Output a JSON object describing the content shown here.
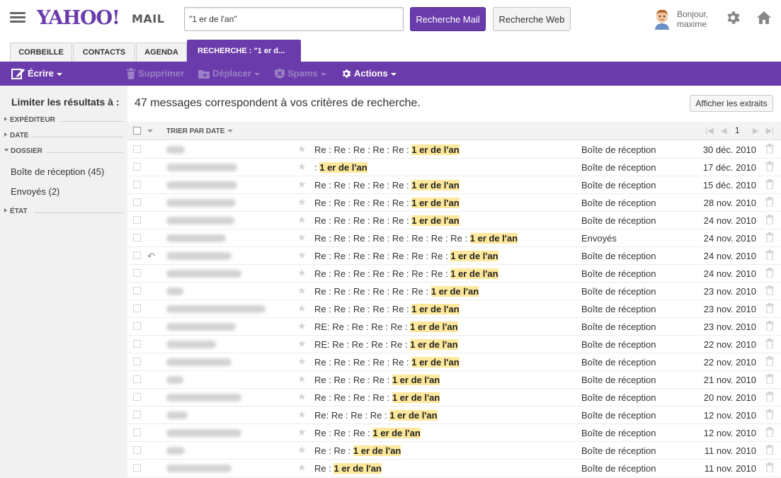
{
  "header": {
    "logo_text": "YAHOO!",
    "logo_mail": "MAIL",
    "search_value": "\"1 er de l'an\"",
    "search_mail_label": "Recherche Mail",
    "search_web_label": "Recherche Web",
    "greeting_line1": "Bonjour,",
    "greeting_line2": "maxime"
  },
  "tabs": [
    {
      "label": "CORBEILLE"
    },
    {
      "label": "CONTACTS"
    },
    {
      "label": "AGENDA"
    },
    {
      "label": "RECHERCHE : \"1 er d..."
    }
  ],
  "toolbar": {
    "write": "Écrire",
    "delete": "Supprimer",
    "move": "Déplacer",
    "spam": "Spams",
    "actions": "Actions"
  },
  "sidebar": {
    "title": "Limiter les résultats à :",
    "sections": {
      "sender": "EXPÉDITEUR",
      "date": "DATE",
      "folder": "DOSSIER",
      "state": "ÉTAT"
    },
    "folders": [
      {
        "name": "Boîte de réception",
        "count": "(45)"
      },
      {
        "name": "Envoyés",
        "count": "(2)"
      }
    ]
  },
  "main": {
    "result_text": "47 messages correspondent à vos critères de recherche.",
    "extracts_button": "Afficher les extraits",
    "sort_label": "TRIER PAR DATE",
    "page_number": "1"
  },
  "colors": {
    "brand": "#6a3cab",
    "highlight": "#fde89b"
  },
  "messages": [
    {
      "prefix": "Re : Re : Re : Re : Re : ",
      "match": "1 er de l'an",
      "folder": "Boîte de réception",
      "date": "30 déc. 2010",
      "replied": false
    },
    {
      "prefix": ": ",
      "match": "1 er de l'an",
      "folder": "Boîte de réception",
      "date": "17 déc. 2010",
      "replied": false
    },
    {
      "prefix": "Re : Re : Re : Re : Re : ",
      "match": "1 er de l'an",
      "folder": "Boîte de réception",
      "date": "15 déc. 2010",
      "replied": false
    },
    {
      "prefix": "Re : Re : Re : Re : Re : ",
      "match": "1 er de l'an",
      "folder": "Boîte de réception",
      "date": "28 nov. 2010",
      "replied": false
    },
    {
      "prefix": "Re : Re : Re : Re : Re : ",
      "match": "1 er de l'an",
      "folder": "Boîte de réception",
      "date": "24 nov. 2010",
      "replied": false
    },
    {
      "prefix": "Re : Re : Re : Re : Re : Re : Re : Re : ",
      "match": "1 er de l'an",
      "folder": "Envoyés",
      "date": "24 nov. 2010",
      "replied": false
    },
    {
      "prefix": "Re : Re : Re : Re : Re : Re : Re : ",
      "match": "1 er de l'an",
      "folder": "Boîte de réception",
      "date": "24 nov. 2010",
      "replied": true
    },
    {
      "prefix": "Re : Re : Re : Re : Re : Re : Re : ",
      "match": "1 er de l'an",
      "folder": "Boîte de réception",
      "date": "24 nov. 2010",
      "replied": false
    },
    {
      "prefix": "Re : Re : Re : Re : Re : Re : ",
      "match": "1 er de l'an",
      "folder": "Boîte de réception",
      "date": "23 nov. 2010",
      "replied": false
    },
    {
      "prefix": "Re : Re : Re : Re : Re : ",
      "match": "1 er de l'an",
      "folder": "Boîte de réception",
      "date": "23 nov. 2010",
      "replied": false
    },
    {
      "prefix": "RE: Re : Re : Re : Re : ",
      "match": "1 er de l'an",
      "folder": "Boîte de réception",
      "date": "23 nov. 2010",
      "replied": false
    },
    {
      "prefix": "RE: Re : Re : Re : Re : ",
      "match": "1 er de l'an",
      "folder": "Boîte de réception",
      "date": "22 nov. 2010",
      "replied": false
    },
    {
      "prefix": "Re : Re : Re : Re : Re : ",
      "match": "1 er de l'an",
      "folder": "Boîte de réception",
      "date": "22 nov. 2010",
      "replied": false
    },
    {
      "prefix": "Re : Re : Re : Re : ",
      "match": "1 er de l'an",
      "folder": "Boîte de réception",
      "date": "21 nov. 2010",
      "replied": false
    },
    {
      "prefix": "Re : Re : Re : Re : ",
      "match": "1 er de l'an",
      "folder": "Boîte de réception",
      "date": "20 nov. 2010",
      "replied": false
    },
    {
      "prefix": "Re: Re : Re : Re : ",
      "match": "1 er de l'an",
      "folder": "Boîte de réception",
      "date": "12 nov. 2010",
      "replied": false
    },
    {
      "prefix": "Re : Re : Re : ",
      "match": "1 er de l'an",
      "folder": "Boîte de réception",
      "date": "12 nov. 2010",
      "replied": false
    },
    {
      "prefix": "Re : Re : ",
      "match": "1 er de l'an",
      "folder": "Boîte de réception",
      "date": "11 nov. 2010",
      "replied": false
    },
    {
      "prefix": "Re : ",
      "match": "1 er de l'an",
      "folder": "Boîte de réception",
      "date": "11 nov. 2010",
      "replied": false
    }
  ]
}
